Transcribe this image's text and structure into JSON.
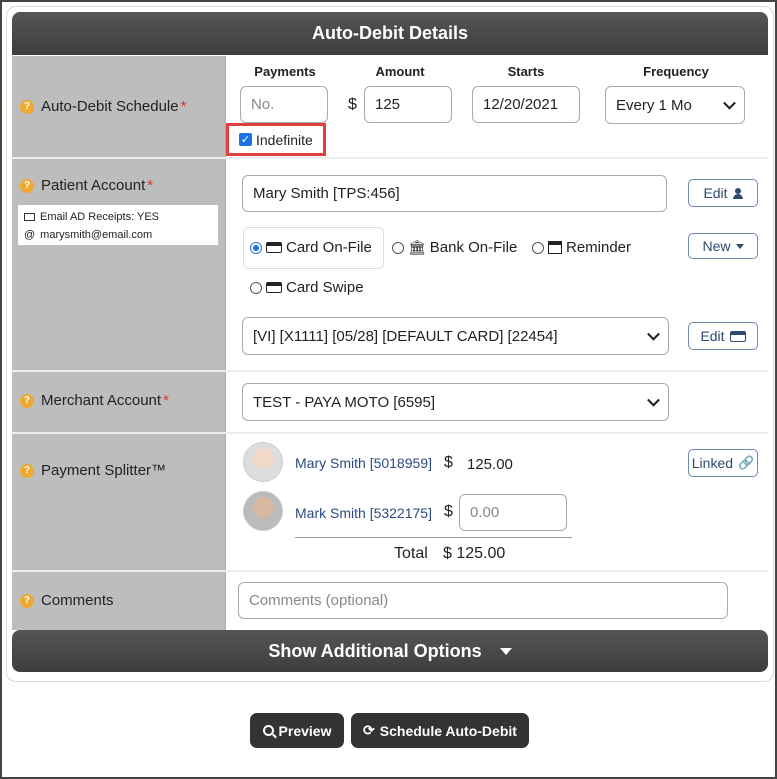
{
  "header": {
    "title": "Auto-Debit Details"
  },
  "schedule": {
    "label": "Auto-Debit Schedule",
    "cols": {
      "payments": "Payments",
      "amount": "Amount",
      "starts": "Starts",
      "frequency": "Frequency"
    },
    "payments_placeholder": "No.",
    "currency": "$",
    "amount_value": "125",
    "starts_value": "12/20/2021",
    "frequency_value": "Every 1 Mo",
    "indefinite_label": "Indefinite",
    "indefinite_checked": true
  },
  "patient": {
    "label": "Patient Account",
    "receipts_note": "Email AD Receipts: YES",
    "email": "marysmith@email.com",
    "account_value": "Mary Smith [TPS:456]",
    "edit_label": "Edit",
    "new_label": "New",
    "methods": [
      "Card On-File",
      "Bank On-File",
      "Reminder",
      "Card Swipe"
    ],
    "selected_method": "Card On-File",
    "card_value": "[VI] [X1111] [05/28] [DEFAULT CARD] [22454]",
    "card_edit_label": "Edit"
  },
  "merchant": {
    "label": "Merchant Account",
    "value": "TEST - PAYA MOTO [6595]"
  },
  "splitter": {
    "label": "Payment Splitter™",
    "linked_label": "Linked",
    "currency": "$",
    "people": [
      {
        "name": "Mary Smith",
        "id": "[5018959]",
        "amount": "125.00"
      },
      {
        "name": "Mark Smith",
        "id": "[5322175]",
        "placeholder": "0.00"
      }
    ],
    "total_label": "Total",
    "total_value": "$ 125.00"
  },
  "comments": {
    "label": "Comments",
    "placeholder": "Comments (optional)"
  },
  "more": {
    "label": "Show Additional Options"
  },
  "actions": {
    "preview": "Preview",
    "schedule": "Schedule Auto-Debit"
  }
}
